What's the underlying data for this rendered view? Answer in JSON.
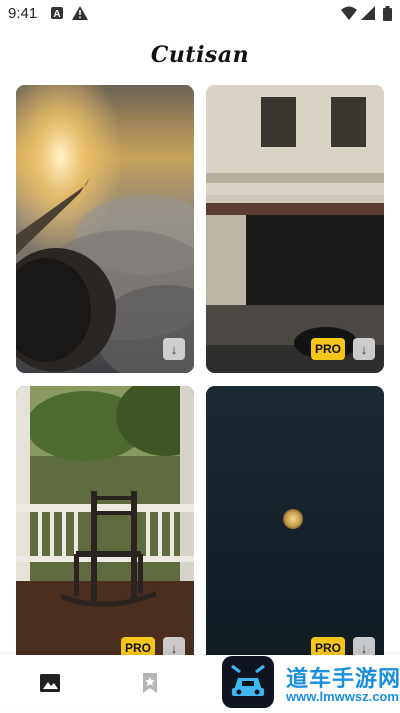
{
  "status_bar": {
    "time": "9:41",
    "icons": [
      "notification-a-icon",
      "warning-icon",
      "wifi-icon",
      "signal-icon",
      "battery-icon"
    ]
  },
  "app": {
    "title": "Cutisan"
  },
  "wallpapers": [
    {
      "subject": "airplane wing above clouds at sunset",
      "pro": false,
      "download_icon": "↓"
    },
    {
      "subject": "corner cafe building on a street",
      "pro": true,
      "badge": "PRO",
      "download_icon": "↓"
    },
    {
      "subject": "rocking chair on a porch",
      "pro": true,
      "badge": "PRO",
      "download_icon": "↓"
    },
    {
      "subject": "full moon in a dark sky",
      "pro": true,
      "badge": "PRO",
      "download_icon": "↓"
    }
  ],
  "bottom_nav": {
    "tabs": [
      {
        "name": "gallery",
        "icon": "image-icon",
        "active": true
      },
      {
        "name": "favorites",
        "icon": "bookmark-star-icon",
        "active": false
      }
    ]
  },
  "watermark": {
    "text": "道车手游网",
    "url": "www.lmwwsz.com"
  },
  "colors": {
    "pro_badge": "#f5c518",
    "watermark": "#1a8fe0",
    "background": "#ffffff"
  }
}
